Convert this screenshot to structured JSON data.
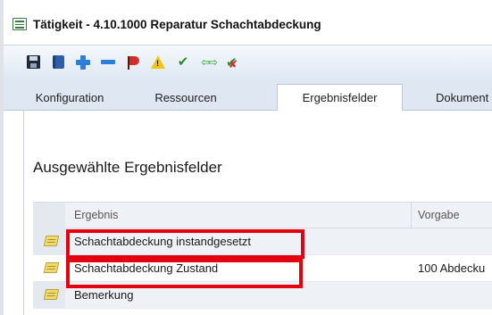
{
  "window": {
    "title": "Tätigkeit - 4.10.1000 Reparatur Schachtabdeckung"
  },
  "toolbar": {
    "buttons": [
      {
        "icon": "save-icon"
      },
      {
        "icon": "book-icon"
      },
      {
        "icon": "add-icon"
      },
      {
        "icon": "remove-icon"
      },
      {
        "icon": "flag-icon"
      },
      {
        "icon": "warning-icon"
      },
      {
        "icon": "checkmark-icon"
      },
      {
        "icon": "arrows-icon"
      },
      {
        "icon": "check-cancel-icon"
      }
    ]
  },
  "tabs": [
    {
      "label": "Konfiguration",
      "active": false
    },
    {
      "label": "Ressourcen",
      "active": false
    },
    {
      "label": "Ergebnisfelder",
      "active": true
    },
    {
      "label": "Dokument",
      "active": false
    }
  ],
  "section": {
    "title": "Ausgewählte Ergebnisfelder"
  },
  "grid": {
    "columns": [
      "Ergebnis",
      "Vorgabe"
    ],
    "rows": [
      {
        "ergebnis": "Schachtabdeckung instandgesetzt",
        "vorgabe": "",
        "highlighted": true
      },
      {
        "ergebnis": "Schachtabdeckung Zustand",
        "vorgabe": "100 Abdecku",
        "highlighted": true
      },
      {
        "ergebnis": "Bemerkung",
        "vorgabe": "",
        "highlighted": false
      }
    ]
  },
  "colors": {
    "highlight": "#e3000f",
    "toolbar_bg": "#dfe8f3",
    "tab_bg": "#dfe8f2"
  }
}
